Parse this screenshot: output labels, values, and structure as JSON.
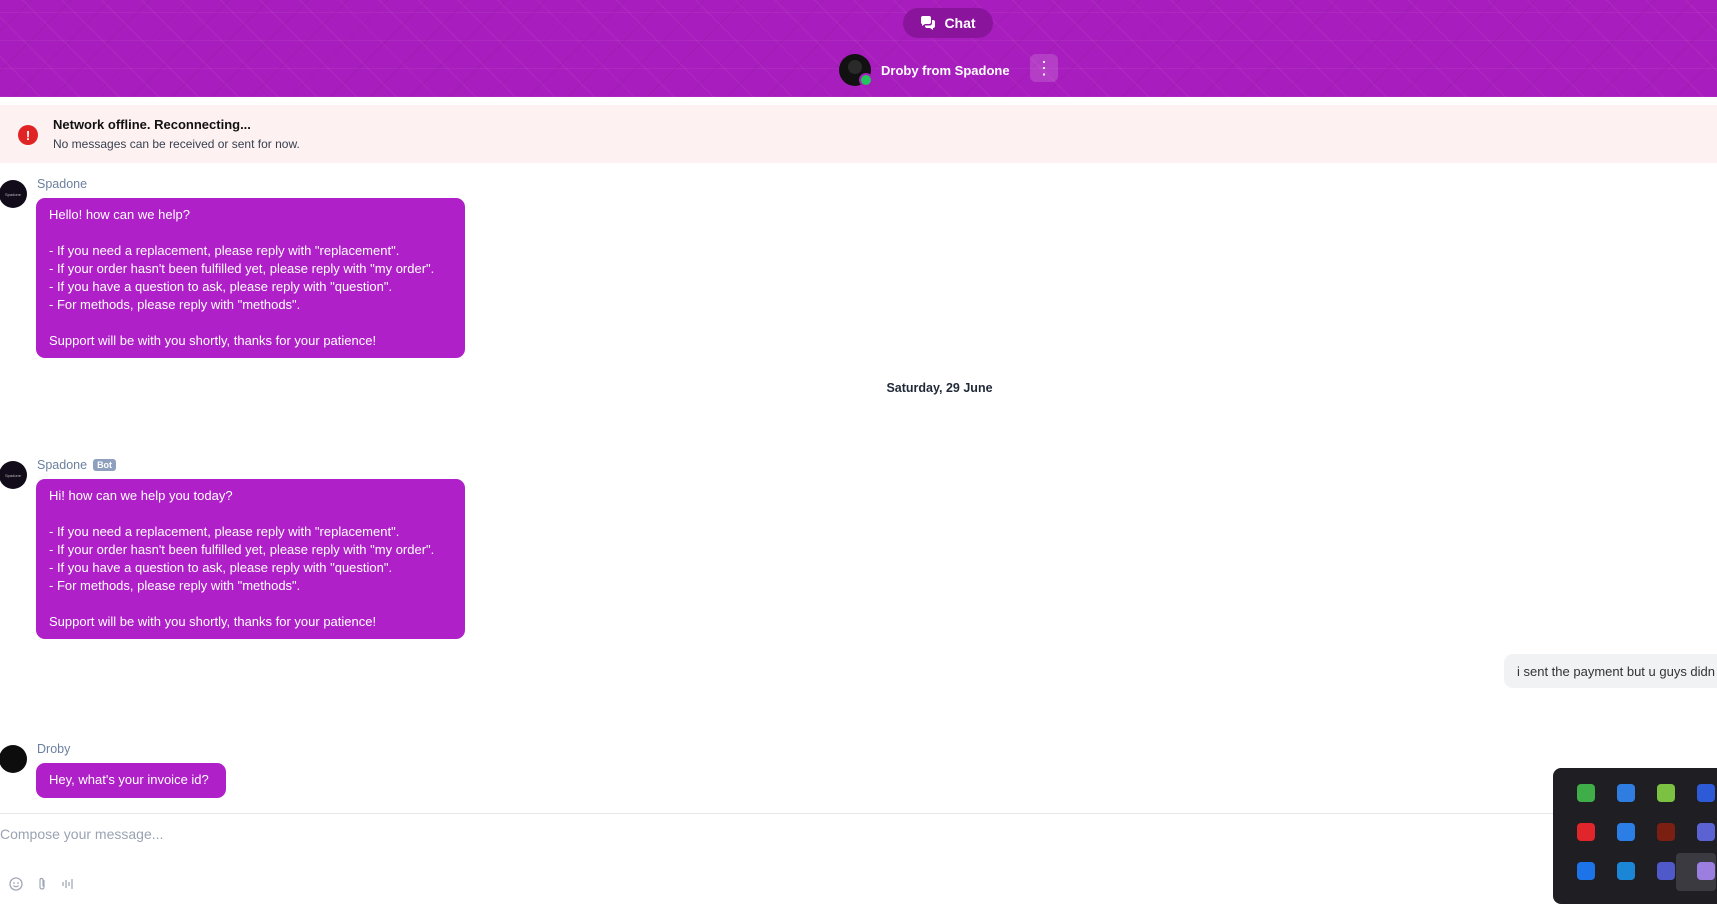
{
  "header": {
    "chat_label": "Chat",
    "agent_name": "Droby from Spadone"
  },
  "banner": {
    "title": "Network offline. Reconnecting...",
    "subtitle": "No messages can be received or sent for now."
  },
  "messages": [
    {
      "sender": "Spadone",
      "avatar_text": "Spadone",
      "lines": [
        "Hello! how can we help?",
        "",
        "- If you need a replacement, please reply with \"replacement\".",
        "- If your order hasn't been fulfilled yet, please reply with \"my order\".",
        "- If you have a question to ask, please reply with \"question\".",
        "- For methods, please reply with \"methods\".",
        "",
        "Support will be with you shortly, thanks for your patience!"
      ]
    },
    {
      "sender": "Spadone",
      "badge": "Bot",
      "avatar_text": "Spadone",
      "lines": [
        "Hi! how can we help you today?",
        "",
        "- If you need a replacement, please reply with \"replacement\".",
        "- If your order hasn't been fulfilled yet, please reply with \"my order\".",
        "- If you have a question to ask, please reply with \"question\".",
        "- For methods, please reply with \"methods\".",
        "",
        "Support will be with you shortly, thanks for your patience!"
      ]
    },
    {
      "sender": "Droby",
      "lines": [
        "Hey, what's your invoice id?"
      ]
    }
  ],
  "date_divider": "Saturday, 29 June",
  "outgoing_message": "i sent the payment but u guys didn",
  "composer": {
    "placeholder": "Compose your message..."
  },
  "tray": {
    "icons": [
      {
        "name": "security-shield-icon",
        "color": "#3fae49"
      },
      {
        "name": "cloud-drive-icon",
        "color": "#2f7de1"
      },
      {
        "name": "bluestacks-icon",
        "color": "#7cc242"
      },
      {
        "name": "malwarebytes-icon",
        "color": "#2d5bd8"
      },
      {
        "name": "chat-app-icon",
        "color": "#e0252b"
      },
      {
        "name": "browser-app-icon",
        "color": "#2a7ee6"
      },
      {
        "name": "game-app-icon",
        "color": "#7a1f12"
      },
      {
        "name": "teams-icon",
        "color": "#5b63d3"
      },
      {
        "name": "bluetooth-icon",
        "color": "#1d74e8"
      },
      {
        "name": "defender-icon",
        "color": "#1b86d6"
      },
      {
        "name": "teams-alt-icon",
        "color": "#5059c9"
      },
      {
        "name": "pen-icon",
        "color": "#9b7ee0"
      }
    ]
  }
}
